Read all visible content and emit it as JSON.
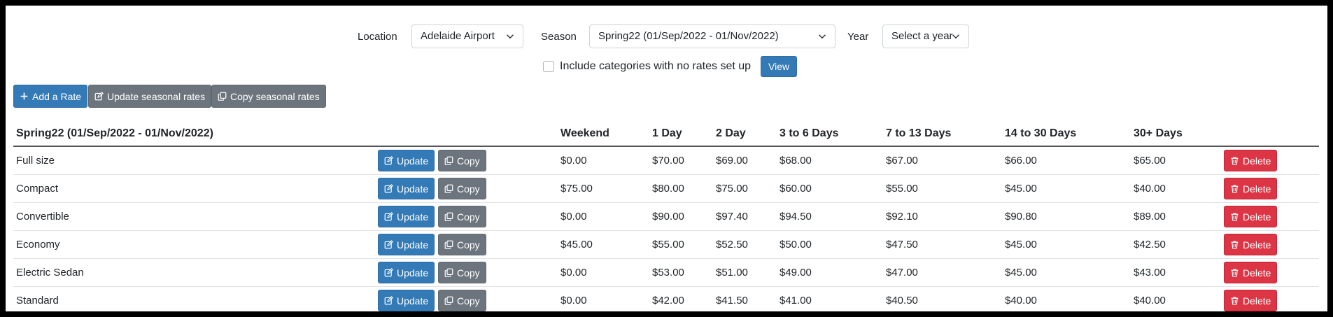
{
  "filters": {
    "location_label": "Location",
    "location_value": "Adelaide Airport",
    "season_label": "Season",
    "season_value": "Spring22 (01/Sep/2022 - 01/Nov/2022)",
    "year_label": "Year",
    "year_value": "Select a year",
    "include_label": "Include categories with no rates set up",
    "view_label": "View"
  },
  "toolbar": {
    "add_rate": "Add a Rate",
    "update_seasonal": "Update seasonal rates",
    "copy_seasonal": "Copy seasonal rates"
  },
  "table": {
    "headers": [
      "Spring22 (01/Sep/2022 - 01/Nov/2022)",
      "Weekend",
      "1 Day",
      "2 Day",
      "3 to 6 Days",
      "7 to 13 Days",
      "14 to 30 Days",
      "30+ Days"
    ],
    "update_label": "Update",
    "copy_label": "Copy",
    "delete_label": "Delete",
    "rows": [
      {
        "name": "Full size",
        "weekend": "$0.00",
        "d1": "$70.00",
        "d2": "$69.00",
        "d3_6": "$68.00",
        "d7_13": "$67.00",
        "d14_30": "$66.00",
        "d30": "$65.00"
      },
      {
        "name": "Compact",
        "weekend": "$75.00",
        "d1": "$80.00",
        "d2": "$75.00",
        "d3_6": "$60.00",
        "d7_13": "$55.00",
        "d14_30": "$45.00",
        "d30": "$40.00"
      },
      {
        "name": "Convertible",
        "weekend": "$0.00",
        "d1": "$90.00",
        "d2": "$97.40",
        "d3_6": "$94.50",
        "d7_13": "$92.10",
        "d14_30": "$90.80",
        "d30": "$89.00"
      },
      {
        "name": "Economy",
        "weekend": "$45.00",
        "d1": "$55.00",
        "d2": "$52.50",
        "d3_6": "$50.00",
        "d7_13": "$47.50",
        "d14_30": "$45.00",
        "d30": "$42.50"
      },
      {
        "name": "Electric Sedan",
        "weekend": "$0.00",
        "d1": "$53.00",
        "d2": "$51.00",
        "d3_6": "$49.00",
        "d7_13": "$47.00",
        "d14_30": "$45.00",
        "d30": "$43.00"
      },
      {
        "name": "Standard",
        "weekend": "$0.00",
        "d1": "$42.00",
        "d2": "$41.50",
        "d3_6": "$41.00",
        "d7_13": "$40.50",
        "d14_30": "$40.00",
        "d30": "$40.00"
      }
    ]
  },
  "colors": {
    "primary": "#337ab7",
    "secondary": "#6c757d",
    "danger": "#dc3545"
  }
}
